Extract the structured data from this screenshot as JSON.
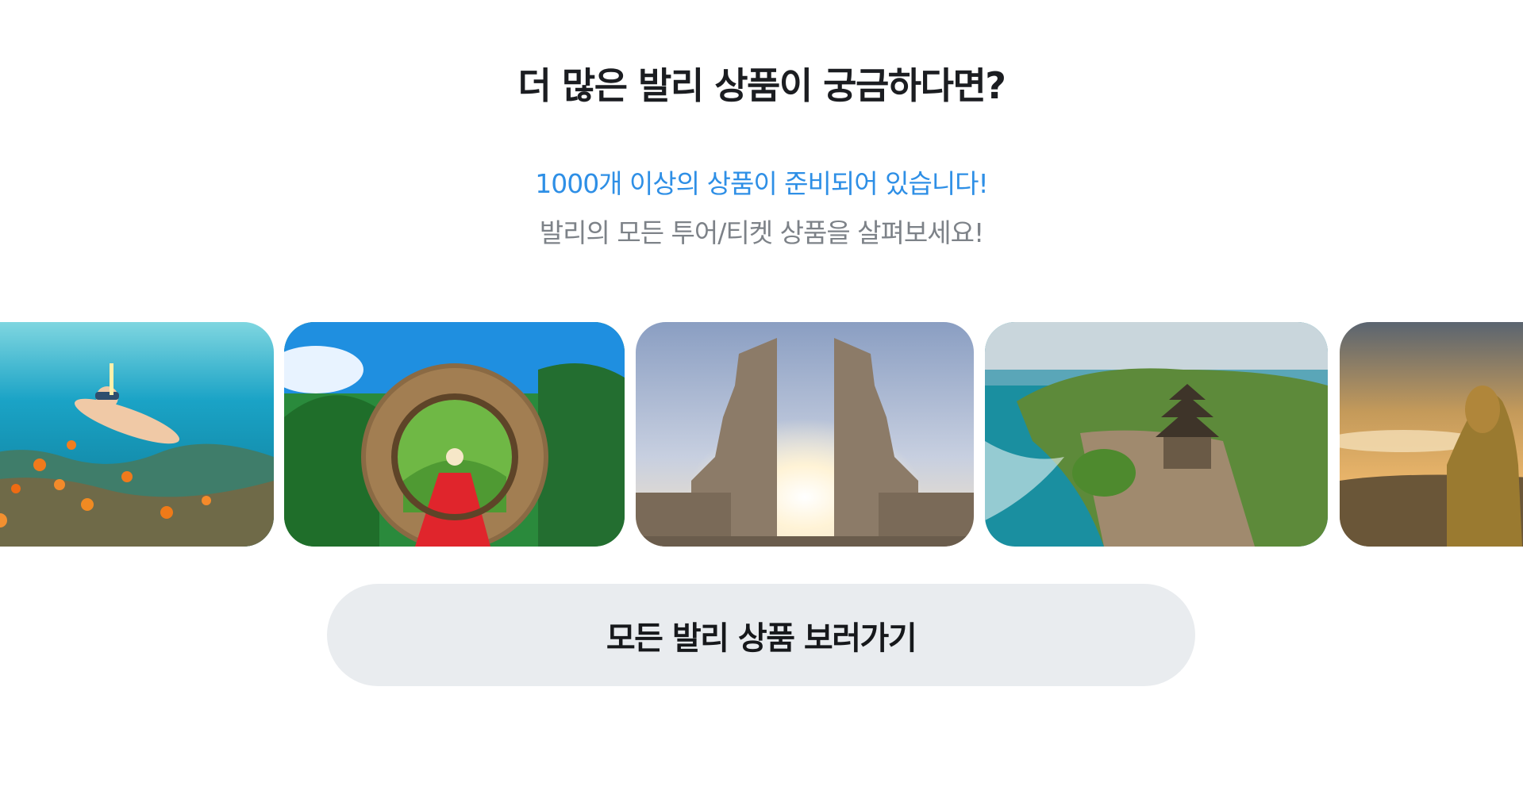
{
  "section": {
    "title": "더 많은 발리 상품이 궁금하다면?",
    "highlight": "1000개 이상의 상품이 준비되어 있습니다!",
    "description": "발리의 모든 투어/티켓 상품을 살펴보세요!"
  },
  "carousel": {
    "slides": [
      {
        "name": "snorkeling"
      },
      {
        "name": "bird-nest-swing"
      },
      {
        "name": "lempuyang-gate"
      },
      {
        "name": "uluwatu-temple"
      },
      {
        "name": "sunrise-view"
      }
    ]
  },
  "cta": {
    "label": "모든 발리 상품 보러가기"
  },
  "colors": {
    "highlight": "#2e8fe6",
    "description": "#7d8288",
    "button_bg": "#e9ecef"
  }
}
